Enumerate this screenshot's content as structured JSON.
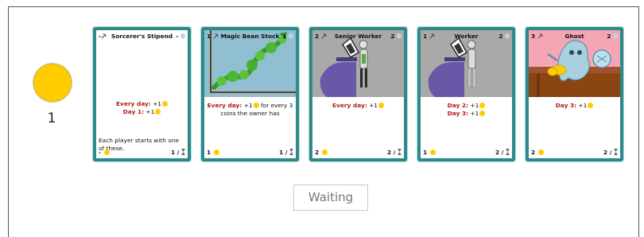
{
  "player": {
    "coins": "1",
    "coin_color": "#ffcc00"
  },
  "status": "Waiting",
  "colors": {
    "card_border": "#2e8a8a",
    "rule_red": "#b01c1c",
    "coin": "#ffcc00"
  },
  "cards": [
    {
      "title": "Sorcerer's Stipend",
      "cost": "-",
      "vp": "-",
      "art": "none",
      "rules": [
        {
          "label": "Every day:",
          "text": " +1"
        },
        {
          "label": "Day 1:",
          "text": " +1"
        }
      ],
      "description": "Each player starts with one of these.",
      "footer_cost": "-",
      "footer_duration": "1 /"
    },
    {
      "title": "Magic Bean Stock",
      "cost": "1",
      "vp": "1",
      "art": "beanstalk",
      "rules": [
        {
          "label": "Every day:",
          "text": " +1",
          "tail": " for every 3 coins the owner has"
        }
      ],
      "footer_cost": "1",
      "footer_duration": "1 /"
    },
    {
      "title": "Senior Worker",
      "cost": "2",
      "vp": "2",
      "art": "senior-worker",
      "rules": [
        {
          "label": "Every day:",
          "text": " +1"
        }
      ],
      "footer_cost": "2",
      "footer_duration": "2 /"
    },
    {
      "title": "Worker",
      "cost": "1",
      "vp": "2",
      "art": "worker",
      "rules": [
        {
          "label": "Day 2:",
          "text": " +1"
        },
        {
          "label": "Day 3:",
          "text": " +1"
        }
      ],
      "footer_cost": "1",
      "footer_duration": "2 /"
    },
    {
      "title": "Ghost",
      "cost": "3",
      "vp": "2",
      "art": "ghost",
      "rules": [
        {
          "label": "Day 3:",
          "text": " +1"
        }
      ],
      "footer_cost": "2",
      "footer_duration": "2 /"
    }
  ]
}
